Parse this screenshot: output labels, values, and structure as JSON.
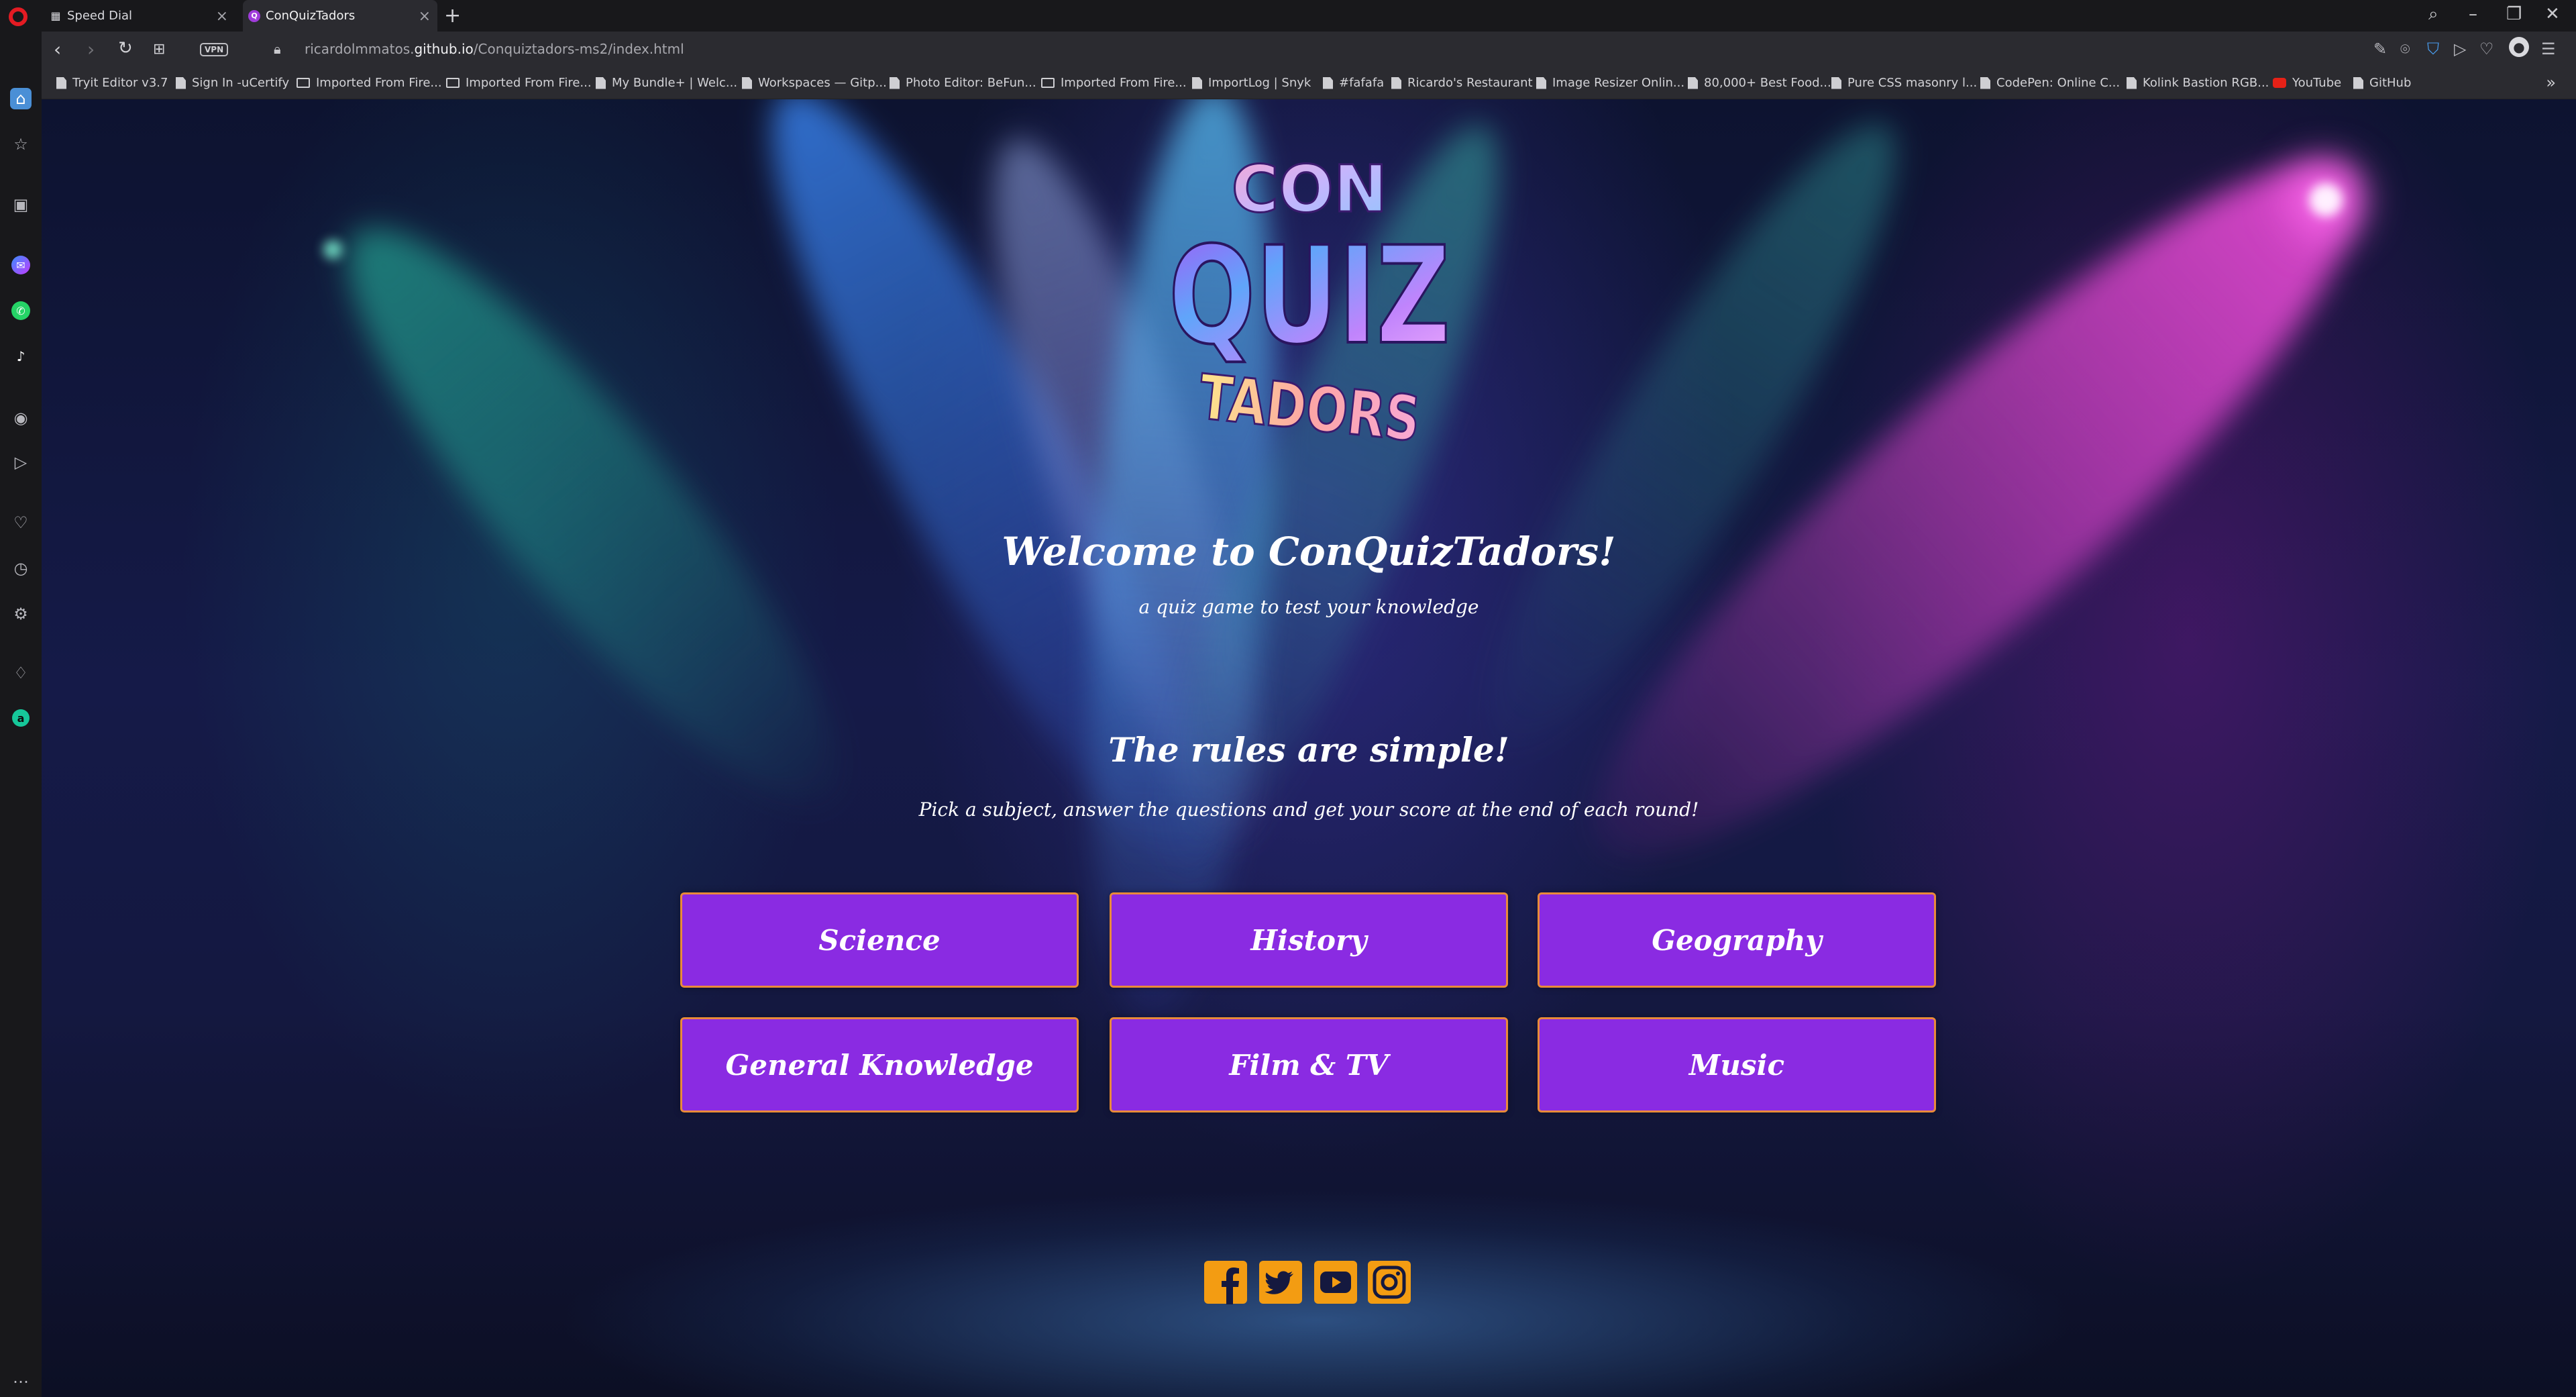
{
  "browser": {
    "tabs": [
      {
        "title": "Speed Dial",
        "icon": "grid-icon"
      },
      {
        "title": "ConQuizTadors",
        "icon": "quiz-favicon"
      }
    ],
    "vpn_label": "VPN",
    "url_prefix": "ricardolmmatos.",
    "url_domain": "github.io",
    "url_path": "/Conquiztadors-ms2/index.html",
    "bookmarks": [
      {
        "label": "Tryit Editor v3.7",
        "type": "page"
      },
      {
        "label": "Sign In -uCertify",
        "type": "page"
      },
      {
        "label": "Imported From Fire...",
        "type": "folder"
      },
      {
        "label": "Imported From Fire...",
        "type": "folder"
      },
      {
        "label": "My Bundle+ | Welc...",
        "type": "page"
      },
      {
        "label": "Workspaces — Gitp...",
        "type": "page"
      },
      {
        "label": "Photo Editor: BeFun...",
        "type": "page"
      },
      {
        "label": "Imported From Fire...",
        "type": "folder"
      },
      {
        "label": "ImportLog | Snyk",
        "type": "page"
      },
      {
        "label": "#fafafa",
        "type": "page"
      },
      {
        "label": "Ricardo's Restaurant",
        "type": "page"
      },
      {
        "label": "Image Resizer Onlin...",
        "type": "page"
      },
      {
        "label": "80,000+ Best Food...",
        "type": "page"
      },
      {
        "label": "Pure CSS masonry l...",
        "type": "page"
      },
      {
        "label": "CodePen: Online C...",
        "type": "page"
      },
      {
        "label": "Kolink Bastion RGB...",
        "type": "page"
      },
      {
        "label": "YouTube",
        "type": "youtube"
      },
      {
        "label": "GitHub",
        "type": "page"
      }
    ]
  },
  "page": {
    "logo_lines": [
      "CON",
      "QUIZ",
      "TADORS"
    ],
    "welcome_title": "Welcome to ConQuizTadors!",
    "welcome_subtitle": "a quiz game to test your knowledge",
    "rules_title": "The rules are simple!",
    "rules_text": "Pick a subject, answer the questions and get your score at the end of each round!",
    "subjects": [
      "Science",
      "History",
      "Geography",
      "General Knowledge",
      "Film & TV",
      "Music"
    ],
    "social": [
      "facebook-icon",
      "twitter-icon",
      "youtube-icon",
      "instagram-icon"
    ]
  },
  "colors": {
    "button_bg": "#8a2be2",
    "button_border": "#e98a3a",
    "social": "#f39c12"
  }
}
